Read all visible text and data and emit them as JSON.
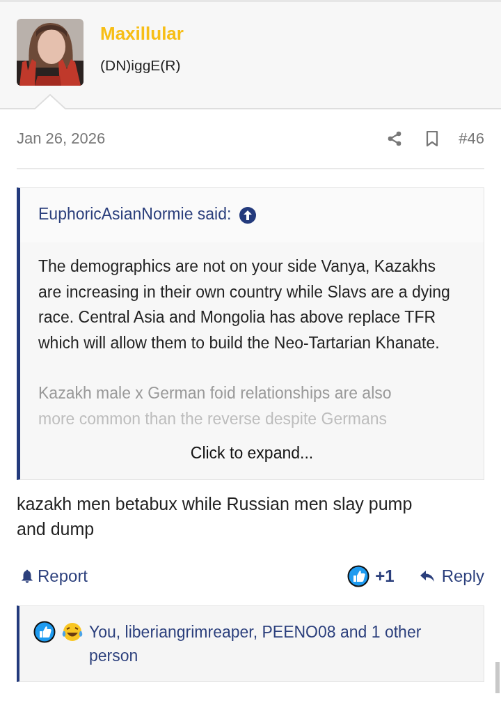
{
  "poster": {
    "name": "Maxillular",
    "title": "(DN)iggE(R)"
  },
  "post_meta": {
    "date": "Jan 26, 2026",
    "number": "#46"
  },
  "quote": {
    "author": "EuphoricAsianNormie said:",
    "paragraphs": [
      "The demographics are not on your side Vanya, Kazakhs are increasing in their own country while Slavs are a dying race. Central Asia and Mongolia has above replace TFR which will allow them to build the Neo-Tartarian Khanate."
    ],
    "faded_lines": [
      "Kazakh male x German foid relationships are also",
      "more common than the reverse despite Germans"
    ],
    "expand_label": "Click to expand..."
  },
  "message": "kazakh men betabux while Russian men slay pump and dump",
  "actions": {
    "report": "Report",
    "like_count": "+1",
    "reply": "Reply"
  },
  "reactions": {
    "text": "You, liberiangrimreaper, PEENO08 and 1 other person"
  }
}
